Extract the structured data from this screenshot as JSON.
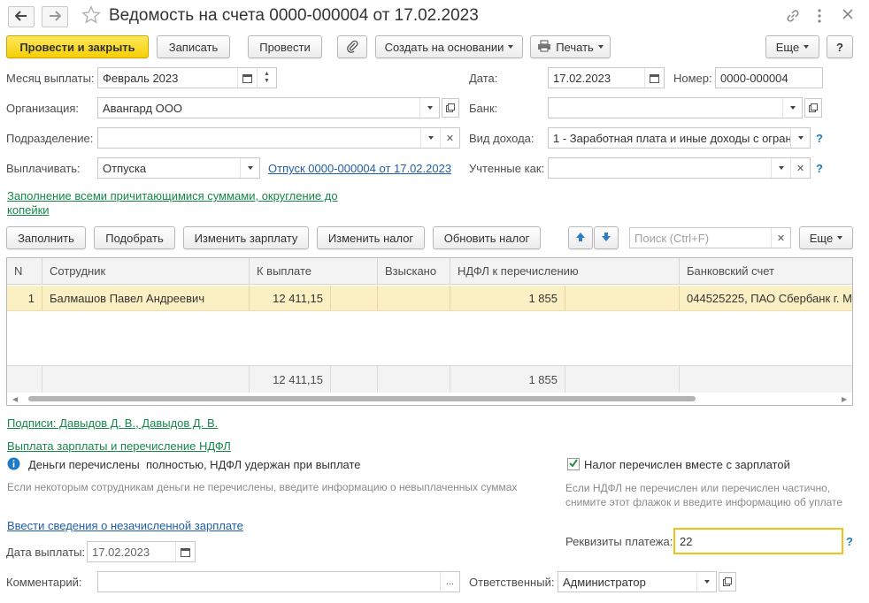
{
  "window": {
    "title": "Ведомость на счета 0000-000004 от 17.02.2023"
  },
  "toolbar": {
    "post_and_close": "Провести и закрыть",
    "save": "Записать",
    "post": "Провести",
    "create_based_on": "Создать на основании",
    "print": "Печать",
    "more": "Еще",
    "help": "?"
  },
  "form": {
    "month_label": "Месяц выплаты:",
    "month_value": "Февраль 2023",
    "date_label": "Дата:",
    "date_value": "17.02.2023",
    "number_label": "Номер:",
    "number_value": "0000-000004",
    "org_label": "Организация:",
    "org_value": "Авангард ООО",
    "bank_label": "Банк:",
    "bank_value": "",
    "division_label": "Подразделение:",
    "division_value": "",
    "income_type_label": "Вид дохода:",
    "income_type_value": "1 - Заработная плата и иные доходы с огран",
    "pay_label": "Выплачивать:",
    "pay_value": "Отпуска",
    "pay_doc_link": "Отпуск 0000-000004 от 17.02.2023",
    "counted_as_label": "Учтенные как:",
    "counted_as_value": "",
    "fill_mode_link": "Заполнение всеми причитающимися суммами, округление до копейки"
  },
  "table_toolbar": {
    "fill": "Заполнить",
    "pick": "Подобрать",
    "change_salary": "Изменить зарплату",
    "change_tax": "Изменить налог",
    "update_tax": "Обновить налог",
    "search_placeholder": "Поиск (Ctrl+F)",
    "more": "Еще"
  },
  "table": {
    "columns": [
      "N",
      "Сотрудник",
      "К выплате",
      "Взыскано",
      "НДФЛ к перечислению",
      "Банковский счет"
    ],
    "rows": [
      {
        "n": "1",
        "employee": "Балмашов Павел Андреевич",
        "to_pay": "12 411,15",
        "collected": "",
        "ndfl": "1 855",
        "account": "044525225, ПАО Сбербанк г. М"
      }
    ],
    "totals": {
      "to_pay": "12 411,15",
      "ndfl": "1 855"
    }
  },
  "bottom": {
    "signatures_link": "Подписи: Давыдов Д. В., Давыдов Д. В.",
    "payment_link": "Выплата зарплаты и перечисление НДФЛ",
    "money_status": "Деньги перечислены  полностью, НДФЛ удержан при выплате",
    "money_hint": "Если некоторым сотрудникам деньги не перечислены, введите информацию о невыплаченных суммах",
    "tax_checkbox_label": "Налог перечислен вместе с зарплатой",
    "tax_checked": true,
    "tax_hint": "Если НДФЛ не перечислен или перечислен частично, снимите этот флажок и введите информацию об уплате",
    "unaccrued_link": "Ввести сведения о незачисленной зарплате",
    "payment_details_label": "Реквизиты платежа:",
    "payment_details_value": "22",
    "pay_date_label": "Дата выплаты:",
    "pay_date_value": "17.02.2023",
    "comment_label": "Комментарий:",
    "comment_value": "",
    "responsible_label": "Ответственный:",
    "responsible_value": "Администратор"
  },
  "colors": {
    "primary_button": "#f5cf05",
    "selected_row": "#fbf0c4",
    "link_blue": "#1e5ea8",
    "link_green": "#16884a",
    "focus_border": "#f0c21a",
    "info_blue": "#1e7ac2"
  },
  "icons": [
    "back-arrow-icon",
    "forward-arrow-icon",
    "star-icon",
    "link-icon",
    "more-vertical-icon",
    "close-icon",
    "paperclip-icon",
    "printer-icon",
    "calendar-icon",
    "arrow-up-icon",
    "arrow-down-icon",
    "info-icon",
    "checkmark-icon"
  ]
}
